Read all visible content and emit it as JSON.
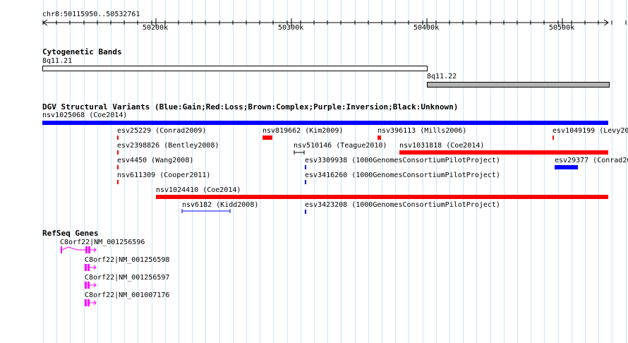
{
  "position_label": "chr8:50115950..50532761",
  "ruler": {
    "tick_labels": [
      "50200k",
      "50300k",
      "50400k",
      "50500k"
    ]
  },
  "cytoband": {
    "title": "Cytogenetic Bands",
    "bands": [
      {
        "name": "8q11.21",
        "color": "#ffffff"
      },
      {
        "name": "8q11.22",
        "color": "#b3b3b3"
      }
    ]
  },
  "dgv": {
    "title": "DGV Structural Variants (Blue:Gain;Red:Loss;Brown:Complex;Purple:Inversion;Black:Unknown)",
    "colors": {
      "gain": "#0000ff",
      "loss": "#ff0000",
      "unknown": "#000000"
    },
    "variants": [
      {
        "label": "nsv1025068 (Coe2014)",
        "type": "gain"
      },
      {
        "label": "esv25229 (Conrad2009)",
        "type": "loss"
      },
      {
        "label": "nsv819662 (Kim2009)",
        "type": "loss"
      },
      {
        "label": "nsv396113 (Mills2006)",
        "type": "loss"
      },
      {
        "label": "esv1049199 (Levy20",
        "type": "loss"
      },
      {
        "label": "esv2398826 (Bentley2008)",
        "type": "loss"
      },
      {
        "label": "nsv510146 (Teague2010)",
        "type": "unknown"
      },
      {
        "label": "nsv1031818 (Coe2014)",
        "type": "loss"
      },
      {
        "label": "esv4450 (Wang2008)",
        "type": "loss"
      },
      {
        "label": "esv3309938 (1000GenomesConsortiumPilotProject)",
        "type": "gain"
      },
      {
        "label": "esv29377 (Conrad20",
        "type": "gain"
      },
      {
        "label": "nsv611309 (Cooper2011)",
        "type": "loss"
      },
      {
        "label": "esv3416260 (1000GenomesConsortiumPilotProject)",
        "type": "gain"
      },
      {
        "label": "nsv1024410 (Coe2014)",
        "type": "loss"
      },
      {
        "label": "nsv6182 (Kidd2008)",
        "type": "gain"
      },
      {
        "label": "esv3423208 (1000GenomesConsortiumPilotProject)",
        "type": "gain"
      }
    ]
  },
  "refseq": {
    "title": "RefSeq Genes",
    "color": "#ff00ff",
    "genes": [
      {
        "label": "C8orf22|NM_001256596"
      },
      {
        "label": "C8orf22|NM_001256598"
      },
      {
        "label": "C8orf22|NM_001256597"
      },
      {
        "label": "C8orf22|NM_001007176"
      }
    ]
  }
}
